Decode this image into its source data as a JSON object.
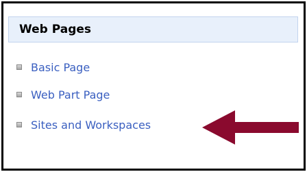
{
  "section": {
    "title": "Web Pages"
  },
  "links": [
    {
      "label": "Basic Page"
    },
    {
      "label": "Web Part Page"
    },
    {
      "label": "Sites and Workspaces"
    }
  ],
  "colors": {
    "header_background": "#e8f0fb",
    "link": "#3a5fc0",
    "arrow": "#8a0a2e",
    "frame_border": "#000000"
  },
  "icons": {
    "bullet": "square-bullet-icon",
    "annotation": "arrow-left-icon"
  }
}
